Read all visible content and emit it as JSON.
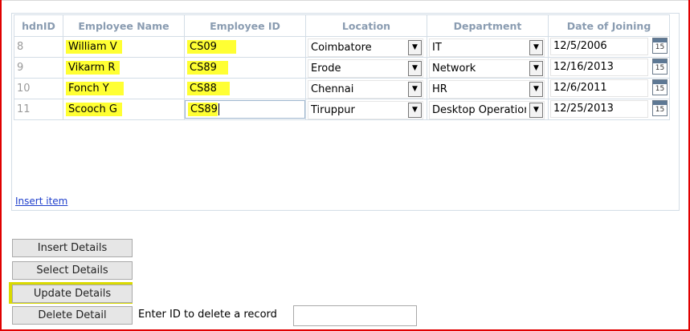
{
  "grid": {
    "columns": [
      "hdnID",
      "Employee Name",
      "Employee ID",
      "Location",
      "Department",
      "Date of Joining"
    ],
    "rows": [
      {
        "hdnid": "8",
        "name": "William V",
        "empid": "CS09",
        "location": "Coimbatore",
        "department": "IT",
        "doj": "12/5/2006"
      },
      {
        "hdnid": "9",
        "name": "Vikarm R",
        "empid": "CS89",
        "location": "Erode",
        "department": "Network",
        "doj": "12/16/2013"
      },
      {
        "hdnid": "10",
        "name": "Fonch Y",
        "empid": "CS88",
        "location": "Chennai",
        "department": "HR",
        "doj": "12/6/2011"
      },
      {
        "hdnid": "11",
        "name": "Scooch G",
        "empid": "CS89",
        "location": "Tiruppur",
        "department": "Desktop Operation",
        "doj": "12/25/2013"
      }
    ],
    "calendar_icon_text": "15",
    "dropdown_arrow": "▼",
    "insert_link": "Insert item"
  },
  "actions": {
    "insert_label": "Insert Details",
    "select_label": "Select Details",
    "update_label": "Update Details",
    "delete_label": "Delete Detail",
    "delete_prompt": "Enter ID to delete a record",
    "delete_input_value": ""
  },
  "colors": {
    "highlight": "#ffff33",
    "window_border": "#e00000",
    "header_text": "#8a9cb1",
    "link": "#1f3fcc"
  }
}
